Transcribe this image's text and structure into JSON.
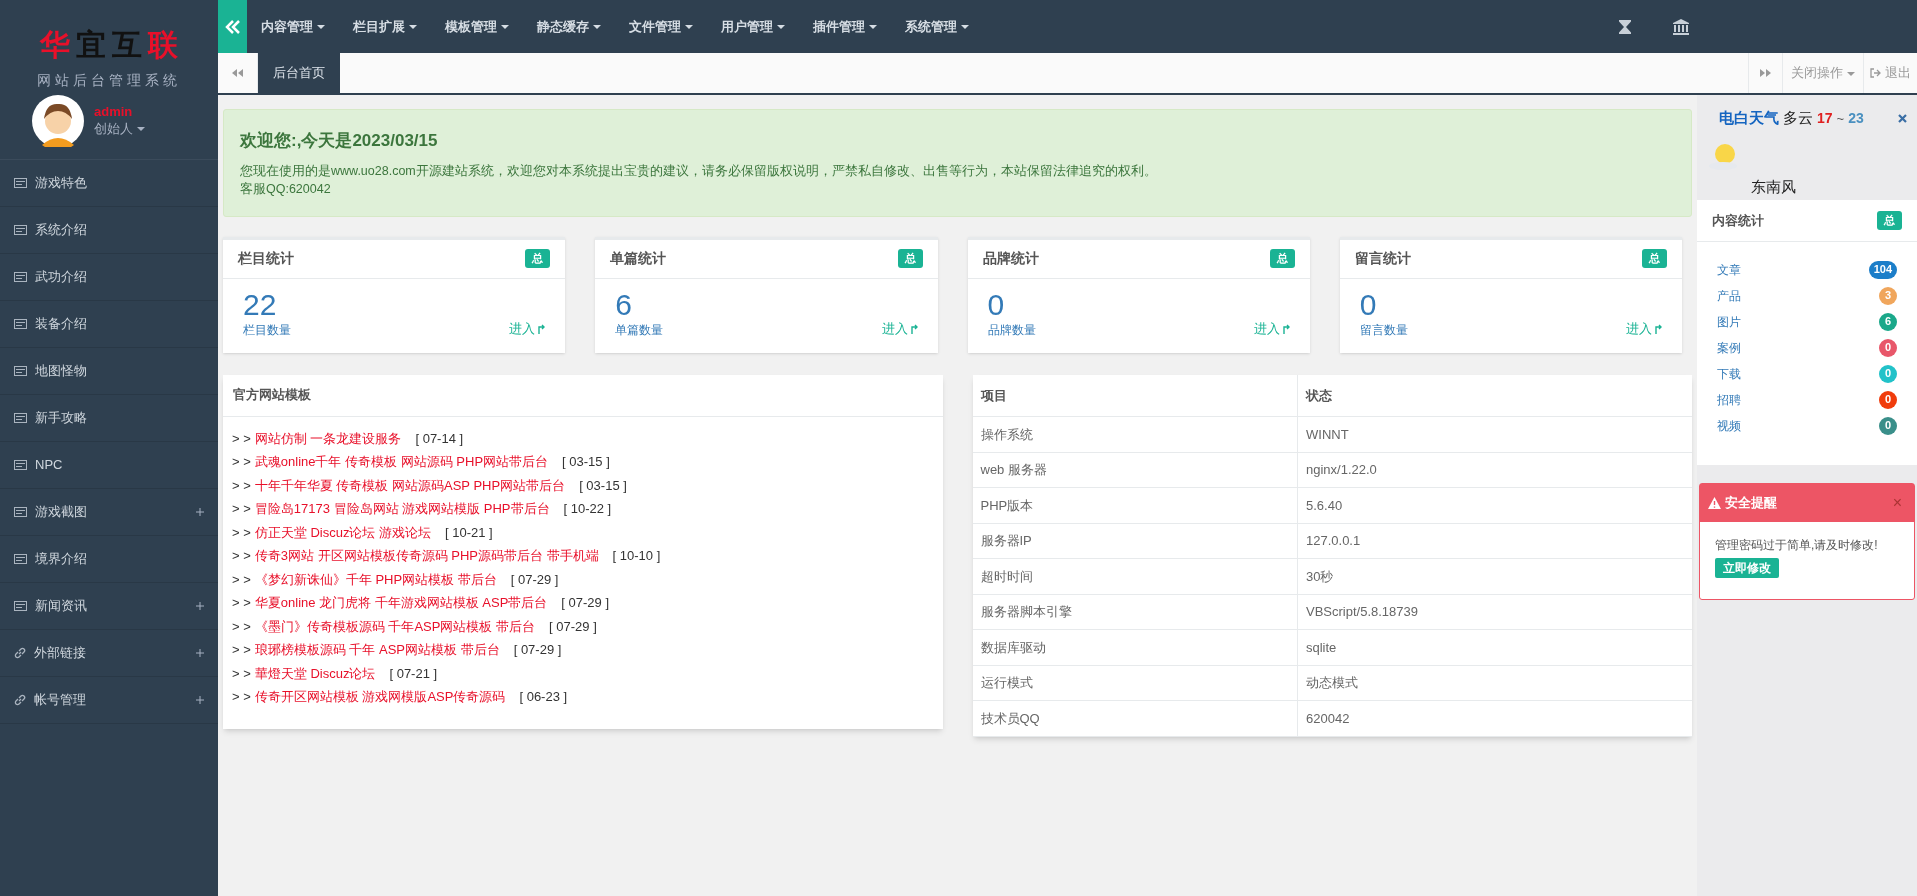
{
  "logo": {
    "chars": [
      {
        "text": "华",
        "color": "#e8102a"
      },
      {
        "text": "宜",
        "color": "#111111"
      },
      {
        "text": "互",
        "color": "#111111"
      },
      {
        "text": "联",
        "color": "#e8102a"
      }
    ],
    "subtitle": "网站后台管理系统"
  },
  "user": {
    "name": "admin",
    "role": "创始人"
  },
  "sidebar": {
    "items": [
      {
        "label": "游戏特色",
        "kind": "card",
        "expandable": false
      },
      {
        "label": "系统介绍",
        "kind": "card",
        "expandable": false
      },
      {
        "label": "武功介绍",
        "kind": "card",
        "expandable": false
      },
      {
        "label": "装备介绍",
        "kind": "card",
        "expandable": false
      },
      {
        "label": "地图怪物",
        "kind": "card",
        "expandable": false
      },
      {
        "label": "新手攻略",
        "kind": "card",
        "expandable": false
      },
      {
        "label": "NPC",
        "kind": "card",
        "expandable": false
      },
      {
        "label": "游戏截图",
        "kind": "card",
        "expandable": true
      },
      {
        "label": "境界介绍",
        "kind": "card",
        "expandable": false
      },
      {
        "label": "新闻资讯",
        "kind": "card",
        "expandable": true
      },
      {
        "label": "外部链接",
        "kind": "link",
        "expandable": true
      },
      {
        "label": "帐号管理",
        "kind": "link",
        "expandable": true
      }
    ]
  },
  "topnav": {
    "menus": [
      "内容管理",
      "栏目扩展",
      "模板管理",
      "静态缓存",
      "文件管理",
      "用户管理",
      "插件管理",
      "系统管理"
    ]
  },
  "tabbar": {
    "tabs": [
      {
        "label": "后台首页",
        "selected": true
      }
    ],
    "close_menu": "关闭操作",
    "logout": "退出"
  },
  "welcome": {
    "title": "欢迎您:,今天是2023/03/15",
    "text": "您现在使用的是www.uo28.com开源建站系统，欢迎您对本系统提出宝贵的建议，请务必保留版权说明，严禁私自修改、出售等行为，本站保留法律追究的权利。",
    "contact": "客服QQ:620042"
  },
  "stats": [
    {
      "title": "栏目统计",
      "badge": "总",
      "value": "22",
      "caption": "栏目数量",
      "link": "进入"
    },
    {
      "title": "单篇统计",
      "badge": "总",
      "value": "6",
      "caption": "单篇数量",
      "link": "进入"
    },
    {
      "title": "品牌统计",
      "badge": "总",
      "value": "0",
      "caption": "品牌数量",
      "link": "进入"
    },
    {
      "title": "留言统计",
      "badge": "总",
      "value": "0",
      "caption": "留言数量",
      "link": "进入"
    }
  ],
  "templates": {
    "title": "官方网站模板",
    "prefix": "> >",
    "items": [
      {
        "title": "网站仿制 一条龙建设服务",
        "date": "[ 07-14 ]"
      },
      {
        "title": "武魂online千年 传奇模板 网站源码 PHP网站带后台",
        "date": "[ 03-15 ]"
      },
      {
        "title": "十年千年华夏 传奇模板 网站源码ASP PHP网站带后台",
        "date": "[ 03-15 ]"
      },
      {
        "title": "冒险岛17173 冒险岛网站 游戏网站模版 PHP带后台",
        "date": "[ 10-22 ]"
      },
      {
        "title": "仿正天堂 Discuz论坛 游戏论坛",
        "date": "[ 10-21 ]"
      },
      {
        "title": "传奇3网站 开区网站模板传奇源码 PHP源码带后台 带手机端",
        "date": "[ 10-10 ]"
      },
      {
        "title": "《梦幻新诛仙》千年 PHP网站模板 带后台",
        "date": "[ 07-29 ]"
      },
      {
        "title": "华夏online 龙门虎将 千年游戏网站模板 ASP带后台",
        "date": "[ 07-29 ]"
      },
      {
        "title": "《墨门》传奇模板源码 千年ASP网站模板 带后台",
        "date": "[ 07-29 ]"
      },
      {
        "title": "琅琊榜模板源码 千年 ASP网站模板 带后台",
        "date": "[ 07-29 ]"
      },
      {
        "title": "華燈天堂 Discuz论坛",
        "date": "[ 07-21 ]"
      },
      {
        "title": "传奇开区网站模板 游戏网模版ASP传奇源码",
        "date": "[ 06-23 ]"
      }
    ]
  },
  "server_table": {
    "columns": [
      "项目",
      "状态"
    ],
    "rows": [
      [
        "操作系统",
        "WINNT"
      ],
      [
        "web 服务器",
        "nginx/1.22.0"
      ],
      [
        "PHP版本",
        "5.6.40"
      ],
      [
        "服务器IP",
        "127.0.0.1"
      ],
      [
        "超时时间",
        "30秒"
      ],
      [
        "服务器脚本引擎",
        "VBScript/5.8.18739"
      ],
      [
        "数据库驱动",
        "sqlite"
      ],
      [
        "运行模式",
        "动态模式"
      ],
      [
        "技术员QQ",
        "620042"
      ]
    ]
  },
  "weather": {
    "city": "电白天气",
    "condition": "多云",
    "low": "17",
    "sep": "~",
    "high": "23",
    "wind": "东南风"
  },
  "content_stats": {
    "title": "内容统计",
    "badge": "总",
    "items": [
      {
        "label": "文章",
        "count": "104",
        "color": "#1c7ec9"
      },
      {
        "label": "产品",
        "count": "3",
        "color": "#f0a65c"
      },
      {
        "label": "图片",
        "count": "6",
        "color": "#1aa88a"
      },
      {
        "label": "案例",
        "count": "0",
        "color": "#e8576a"
      },
      {
        "label": "下载",
        "count": "0",
        "color": "#22c2c9"
      },
      {
        "label": "招聘",
        "count": "0",
        "color": "#f03c0c"
      },
      {
        "label": "视频",
        "count": "0",
        "color": "#3a8f8a"
      }
    ]
  },
  "alert": {
    "title": "安全提醒",
    "close": "×",
    "text": "管理密码过于简单,请及时修改!",
    "button": "立即修改"
  }
}
